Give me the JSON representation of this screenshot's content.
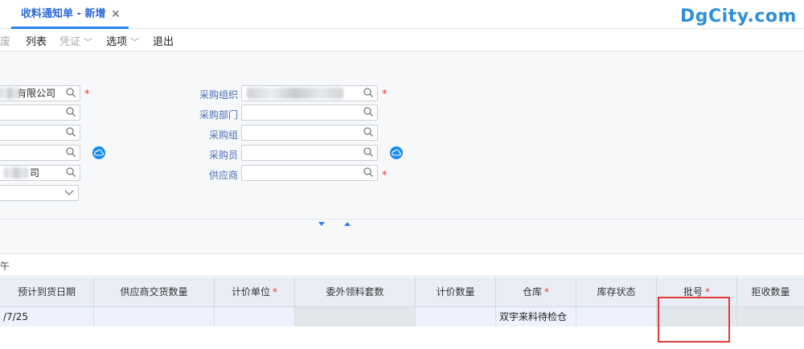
{
  "tab": {
    "title": "收料通知单 - 新增",
    "close": "✕"
  },
  "brand": "DgCity.com",
  "toolbar": {
    "partial_left": "废",
    "list": "列表",
    "voucher": "凭证",
    "options": "选项",
    "exit": "退出"
  },
  "form": {
    "left_fields": {
      "f1_value": "有限公司",
      "f5_value": "司"
    },
    "right_labels": {
      "purchase_org": "采购组织",
      "purchase_dept": "采购部门",
      "purchase_group": "采购组",
      "purchaser": "采购员",
      "supplier": "供应商"
    },
    "required_mark": "*"
  },
  "sub_header_partial": "午",
  "grid": {
    "columns": [
      {
        "label": "预计到货日期",
        "required": false
      },
      {
        "label": "供应商交货数量",
        "required": false
      },
      {
        "label": "计价单位",
        "required": true
      },
      {
        "label": "委外领料套数",
        "required": false
      },
      {
        "label": "计价数量",
        "required": false
      },
      {
        "label": "仓库",
        "required": true
      },
      {
        "label": "库存状态",
        "required": false
      },
      {
        "label": "批号",
        "required": true
      },
      {
        "label": "拒收数量",
        "required": false
      }
    ],
    "row": [
      "/7/25",
      "",
      "",
      "",
      "",
      "双宇来料待检仓",
      "",
      "",
      ""
    ],
    "required_mark": "*"
  },
  "colors": {
    "accent": "#2d7ff0",
    "required": "#e53935",
    "highlight_box": "#e53935"
  }
}
